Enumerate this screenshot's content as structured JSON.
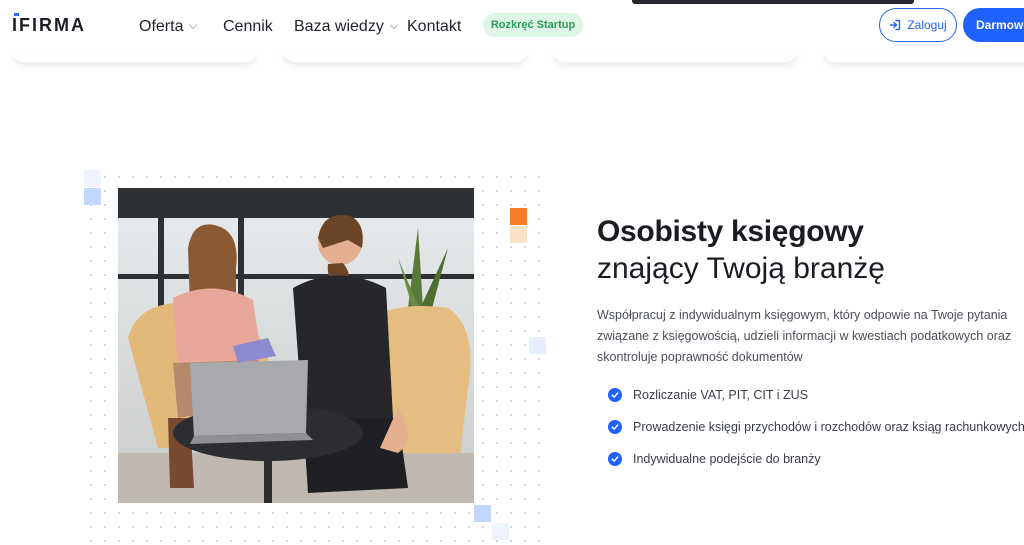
{
  "header": {
    "logo_text": "IFIRMA",
    "nav": [
      {
        "label": "Oferta",
        "has_dropdown": true
      },
      {
        "label": "Cennik",
        "has_dropdown": false
      },
      {
        "label": "Baza wiedzy",
        "has_dropdown": true
      },
      {
        "label": "Kontakt",
        "has_dropdown": false
      }
    ],
    "startup_label": "Rozkręć Startup",
    "login_label": "Zaloguj",
    "cta_label": "Darmowe"
  },
  "section": {
    "title_bold": "Osobisty księgowy",
    "title_light": "znający Twoją branżę",
    "description": "Współpracuj z indywidualnym księgowym, który odpowie na Twoje pytania związane z księgowością, udzieli informacji w kwestiach podatkowych oraz skontroluje poprawność dokumentów",
    "features": [
      "Rozliczanie VAT, PIT, CIT i ZUS",
      "Prowadzenie księgi przychodów i rozchodów oraz ksiąg rachunkowych",
      "Indywidualne podejście do branży"
    ]
  },
  "colors": {
    "brand_blue": "#1f62ff",
    "startup_green": "#2b9b5b",
    "accent_orange": "#f47c2a"
  },
  "icons": {
    "login": "login-arrow-icon",
    "feature_check": "check-circle-icon",
    "dropdown": "chevron-down-icon"
  }
}
